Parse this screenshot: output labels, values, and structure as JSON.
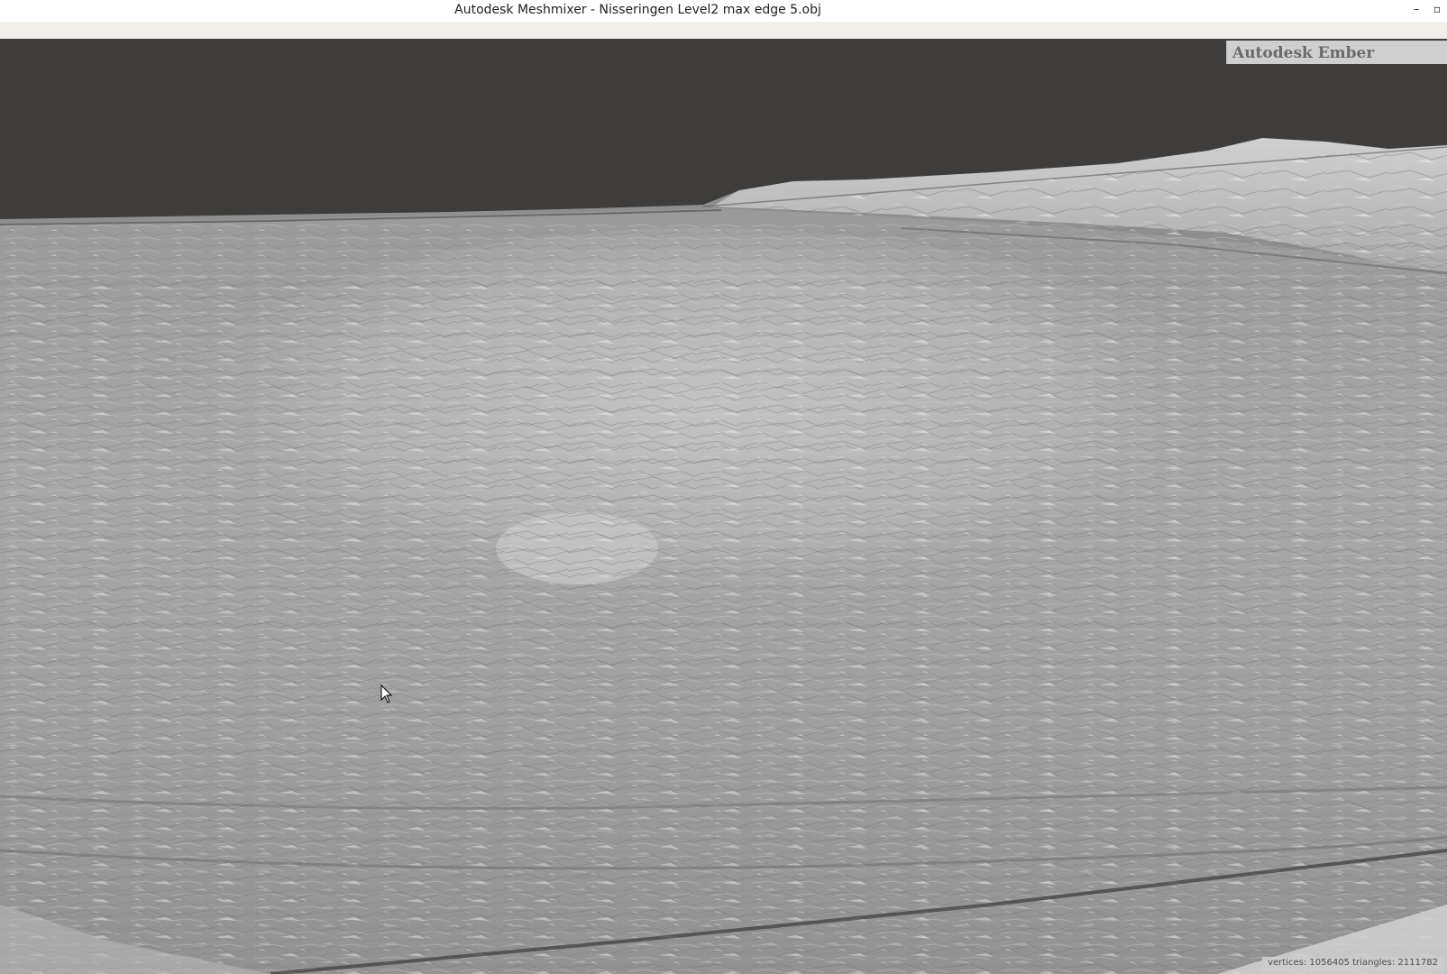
{
  "window": {
    "title": "Autodesk Meshmixer - Nisseringen Level2 max edge 5.obj",
    "minimize_glyph": "–",
    "maximize_glyph": "▫"
  },
  "viewport": {
    "badge_label": "Autodesk Ember",
    "status": {
      "vertices_label": "vertices:",
      "vertices_value": "1056405",
      "triangles_label": "triangles:",
      "triangles_value": "2111782"
    },
    "background_color": "#3e3d3b",
    "mesh_color": "#9c9c9c"
  },
  "icons": {
    "cursor": "mouse-pointer-icon",
    "mesh": "terrain-mesh"
  }
}
